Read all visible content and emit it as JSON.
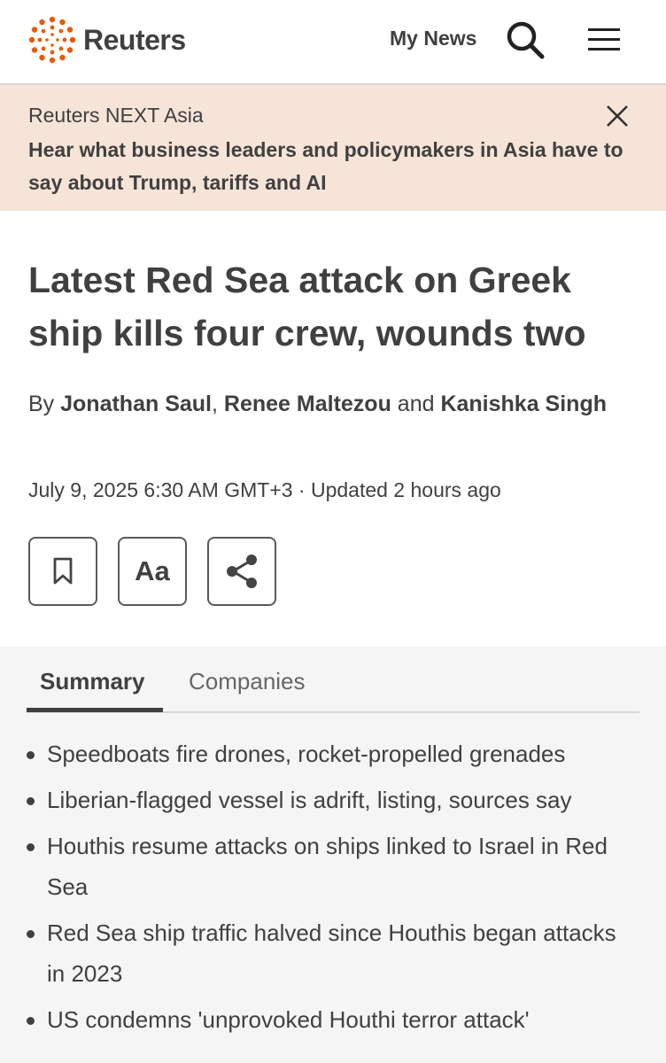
{
  "header": {
    "logo_text": "Reuters",
    "my_news_label": "My News",
    "search_icon": "search-icon",
    "menu_icon": "hamburger-menu-icon"
  },
  "banner": {
    "title": "Reuters NEXT Asia",
    "text": "Hear what business leaders and policymakers in Asia have to say about Trump, tariffs and AI",
    "close_icon": "close-icon"
  },
  "article": {
    "headline": "Latest Red Sea attack on Greek ship kills four crew, wounds two",
    "byline": {
      "prefix": "By ",
      "authors": [
        "Jonathan Saul",
        "Renee Maltezou",
        "Kanishka Singh"
      ],
      "separator": ", ",
      "conjunction": " and "
    },
    "dateline": "July 9, 2025 6:30 AM GMT+3 · Updated 2 hours ago",
    "tools": {
      "bookmark_icon": "bookmark-icon",
      "text_size_label": "Aa",
      "share_icon": "share-icon"
    }
  },
  "tabs": [
    {
      "label": "Summary",
      "active": true
    },
    {
      "label": "Companies",
      "active": false
    }
  ],
  "summary": [
    "Speedboats fire drones, rocket-propelled grenades",
    "Liberian-flagged vessel is adrift, listing, sources say",
    "Houthis resume attacks on ships linked to Israel in Red Sea",
    "Red Sea ship traffic halved since Houthis began attacks in 2023",
    "US condemns 'unprovoked Houthi terror attack'"
  ],
  "colors": {
    "text": "#404040",
    "logo_orange": "#e8590c",
    "banner_bg": "#f6e4d8",
    "summary_bg": "#f5f5f5"
  }
}
